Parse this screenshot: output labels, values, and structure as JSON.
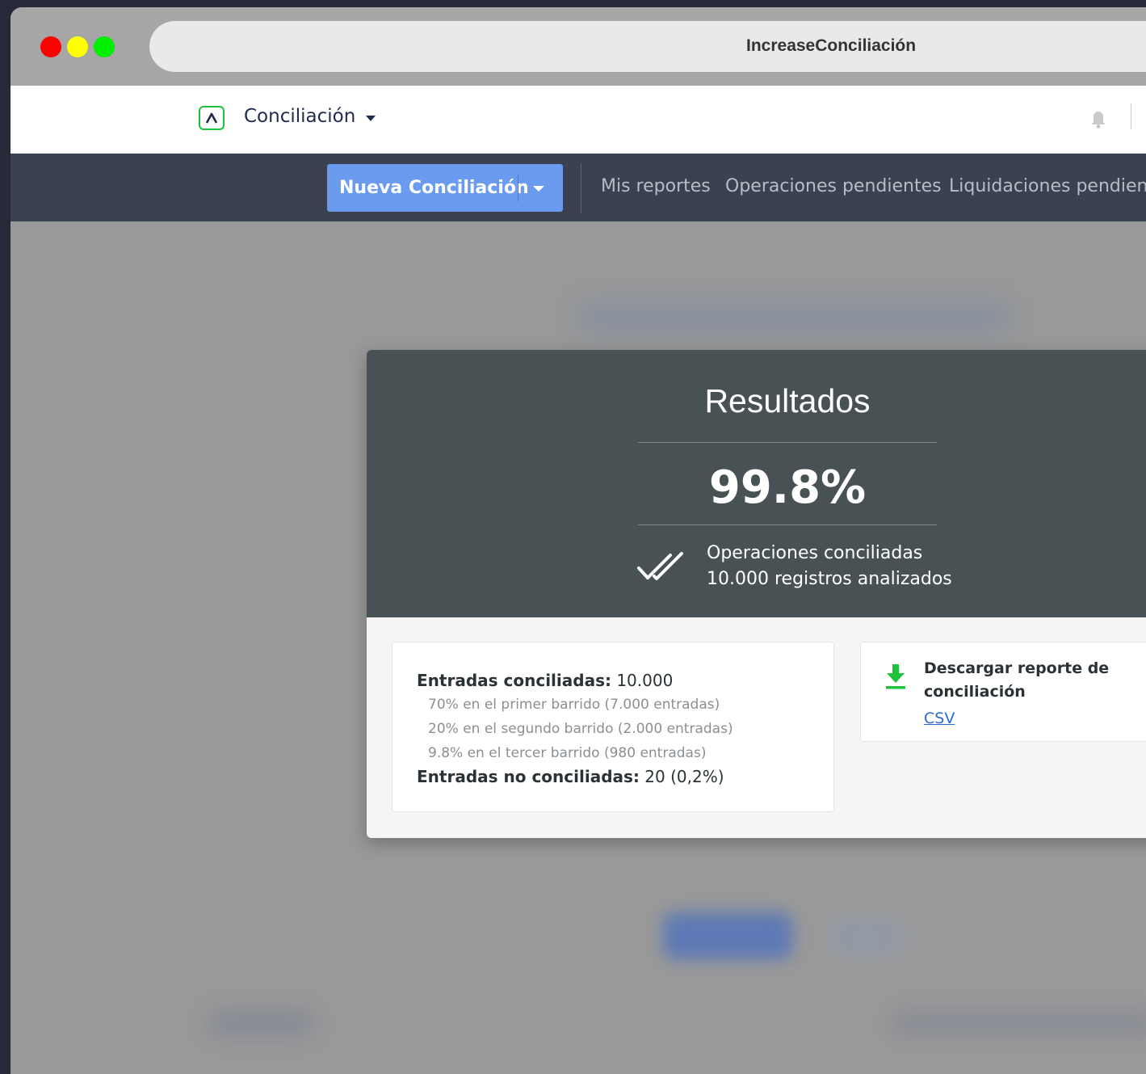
{
  "browser": {
    "window_title": "IncreaseConciliación"
  },
  "app": {
    "name": "Conciliación"
  },
  "navbar": {
    "new_button_label": "Nueva Conciliación",
    "links": [
      "Mis reportes",
      "Operaciones pendientes",
      "Liquidaciones pendient"
    ]
  },
  "results": {
    "title": "Resultados",
    "percent": "99.8%",
    "conciliated_label": "Operaciones conciliadas",
    "records_label": "10.000 registros analizados"
  },
  "summary": {
    "entries_conciliated_label": "Entradas conciliadas:",
    "entries_conciliated_value": " 10.000",
    "sweeps": [
      "70% en el primer barrido (7.000 entradas)",
      "20% en el segundo barrido (2.000 entradas)",
      "9.8% en el tercer barrido (980 entradas)"
    ],
    "entries_not_conciliated_label": "Entradas no conciliadas:",
    "entries_not_conciliated_value": " 20 (0,2%)"
  },
  "download": {
    "title": "Descargar reporte de conciliación",
    "link": "CSV"
  },
  "colors": {
    "accent_green": "#1fc23b",
    "primary_button": "#6a9bee",
    "results_header": "#485254"
  },
  "icons": [
    "traffic-lights",
    "logo-icon",
    "chevron-down-icon",
    "bell-icon",
    "double-check-icon",
    "download-icon"
  ]
}
